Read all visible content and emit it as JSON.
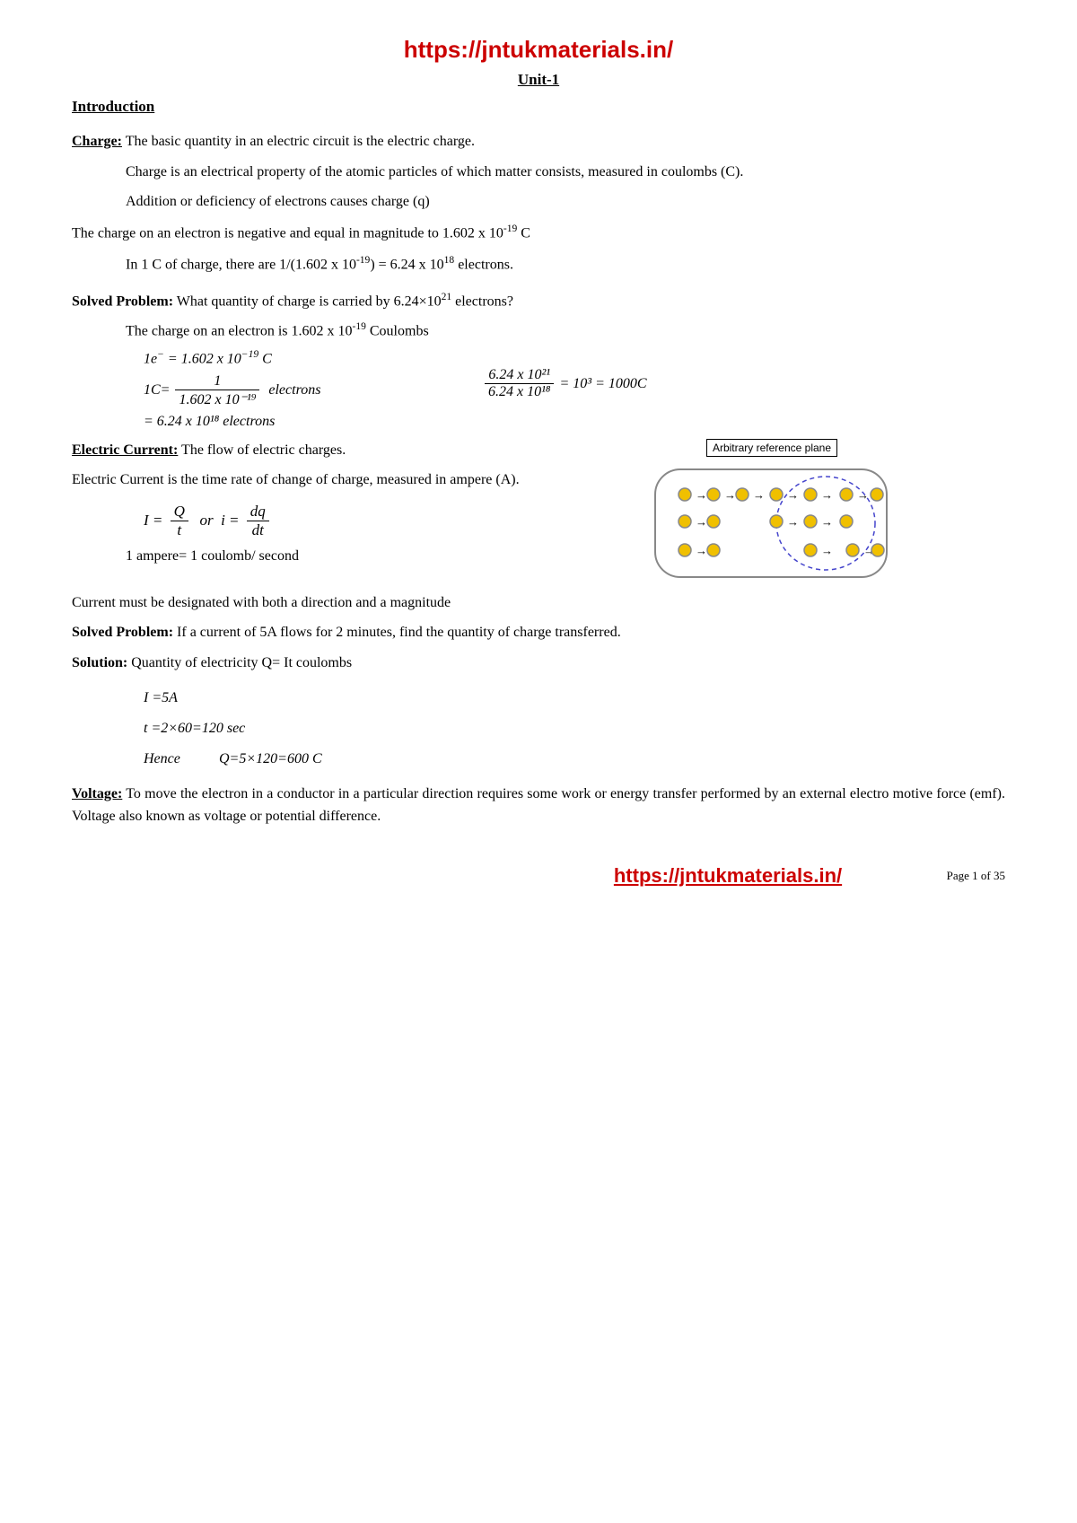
{
  "header": {
    "url": "https://jntukmaterials.in/",
    "unit": "Unit-1"
  },
  "section": {
    "heading": "Introduction",
    "charge": {
      "label": "Charge:",
      "def1": "The basic quantity in an electric circuit is the electric charge.",
      "def2": "Charge is an electrical property of the atomic particles of which matter consists, measured in coulombs (C).",
      "def3": "Addition or deficiency of electrons causes charge (q)",
      "def4": "The charge on an electron is negative and equal in magnitude to 1.602 x 10",
      "def4_sup": "-19",
      "def4_end": " C",
      "def5": "In 1 C of charge, there are 1/(1.602 x 10",
      "def5_sup": "-19",
      "def5_end": ") = 6.24 x 10",
      "def5_sup2": "18",
      "def5_end2": " electrons."
    },
    "solved1": {
      "label": "Solved Problem:",
      "text": " What quantity of charge is carried by 6.24×10",
      "sup": "21",
      "text_end": " electrons?"
    },
    "solved1_ans": "The charge on an electron is 1.602 x 10",
    "solved1_ans_sup": "-19",
    "solved1_ans_end": " Coulombs",
    "math1": {
      "line1": "1e⁻ = 1.602 x 10⁻¹⁹ C",
      "line2_num": "1",
      "line2_den": "1.602  x  10⁻¹⁹",
      "line2_suffix": " electrons",
      "line3": "= 6.24  x  10¹⁸ electrons"
    },
    "math1_right": {
      "num": "6.24  x  10²¹",
      "den": "6.24  x  10¹⁸",
      "eq": " = 10³ = 1000C"
    },
    "electric_current": {
      "label": "Electric Current:",
      "def1": " The flow of electric charges.",
      "def2": "Electric Current is the time rate of change of charge, measured in ampere (A).",
      "diagram_label": "Arbitrary reference plane",
      "formula1": "I =",
      "formula1_Q": "Q",
      "formula1_t": "t",
      "formula1_or": " or  i =",
      "formula1_dq": "dq",
      "formula1_dt": "dt",
      "ampere_note": "1 ampere= 1 coulomb/ second",
      "direction_note": "Current must be designated with both a direction and a magnitude"
    },
    "solved2": {
      "label": "Solved Problem:",
      "text": " If a current of 5A flows for 2 minutes, find the quantity of charge transferred."
    },
    "solution": {
      "label": "Solution:",
      "text": "    Quantity of electricity Q= It coulombs",
      "line1": "I =5A",
      "line2": "t =2×60=120 sec",
      "line3": "Hence",
      "line3_end": "      Q=5×120=600 C"
    },
    "voltage": {
      "label": "Voltage:",
      "text": " To move the electron in a conductor in a particular direction requires some work or    energy transfer performed by an external electro motive force (emf). Voltage also known as voltage or potential difference."
    }
  },
  "footer": {
    "url": "https://jntukmaterials.in/",
    "page": "Page 1 of 35"
  }
}
